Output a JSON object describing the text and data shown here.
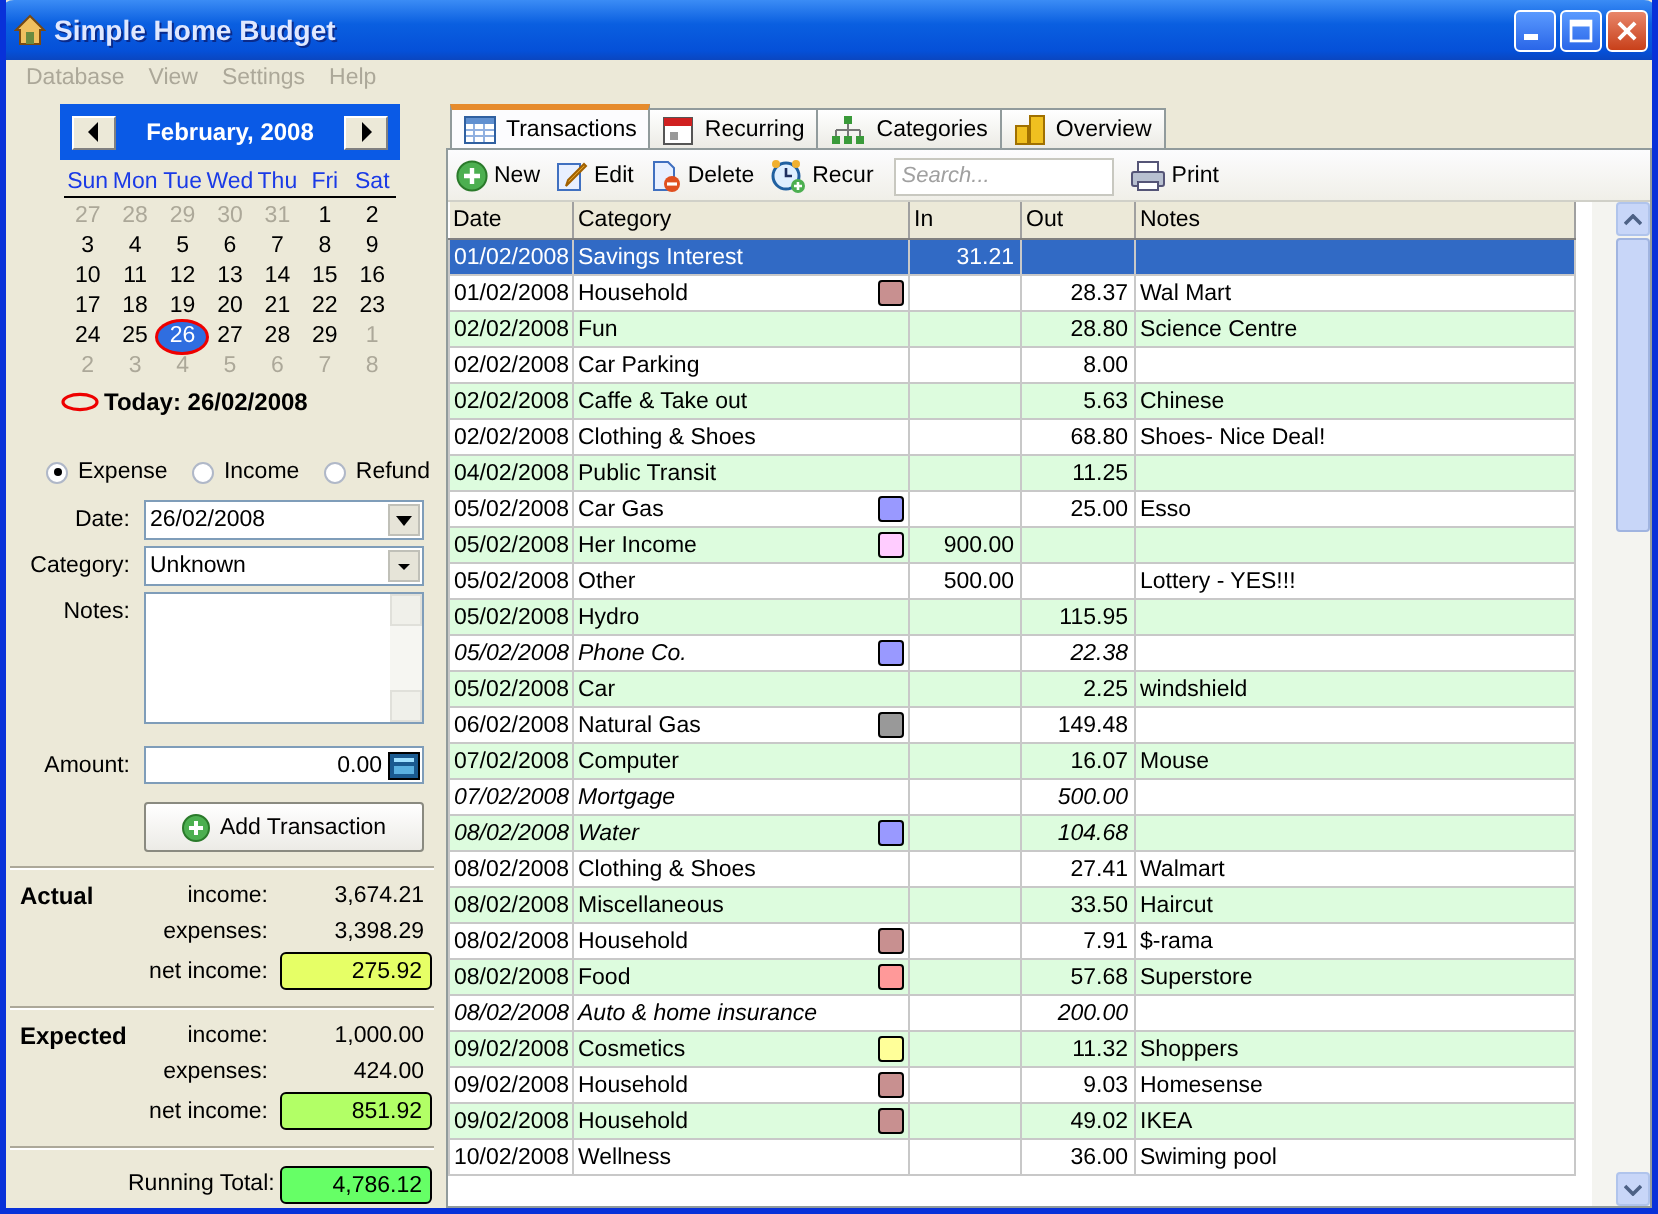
{
  "window": {
    "title": "Simple Home Budget"
  },
  "menu": [
    {
      "label": "Database",
      "disabled": true
    },
    {
      "label": "View",
      "disabled": true
    },
    {
      "label": "Settings",
      "disabled": true
    },
    {
      "label": "Help",
      "disabled": true
    }
  ],
  "calendar": {
    "month": "February, 2008",
    "weekdays": [
      "Sun",
      "Mon",
      "Tue",
      "Wed",
      "Thu",
      "Fri",
      "Sat"
    ],
    "weeks": [
      [
        {
          "d": "27",
          "outside": true,
          "selected": false
        },
        {
          "d": "28",
          "outside": true,
          "selected": false
        },
        {
          "d": "29",
          "outside": true,
          "selected": false
        },
        {
          "d": "30",
          "outside": true,
          "selected": false
        },
        {
          "d": "31",
          "outside": true,
          "selected": false
        },
        {
          "d": "1",
          "outside": false,
          "selected": false
        },
        {
          "d": "2",
          "outside": false,
          "selected": false
        }
      ],
      [
        {
          "d": "3",
          "outside": false,
          "selected": false
        },
        {
          "d": "4",
          "outside": false,
          "selected": false
        },
        {
          "d": "5",
          "outside": false,
          "selected": false
        },
        {
          "d": "6",
          "outside": false,
          "selected": false
        },
        {
          "d": "7",
          "outside": false,
          "selected": false
        },
        {
          "d": "8",
          "outside": false,
          "selected": false
        },
        {
          "d": "9",
          "outside": false,
          "selected": false
        }
      ],
      [
        {
          "d": "10",
          "outside": false,
          "selected": false
        },
        {
          "d": "11",
          "outside": false,
          "selected": false
        },
        {
          "d": "12",
          "outside": false,
          "selected": false
        },
        {
          "d": "13",
          "outside": false,
          "selected": false
        },
        {
          "d": "14",
          "outside": false,
          "selected": false
        },
        {
          "d": "15",
          "outside": false,
          "selected": false
        },
        {
          "d": "16",
          "outside": false,
          "selected": false
        }
      ],
      [
        {
          "d": "17",
          "outside": false,
          "selected": false
        },
        {
          "d": "18",
          "outside": false,
          "selected": false
        },
        {
          "d": "19",
          "outside": false,
          "selected": false
        },
        {
          "d": "20",
          "outside": false,
          "selected": false
        },
        {
          "d": "21",
          "outside": false,
          "selected": false
        },
        {
          "d": "22",
          "outside": false,
          "selected": false
        },
        {
          "d": "23",
          "outside": false,
          "selected": false
        }
      ],
      [
        {
          "d": "24",
          "outside": false,
          "selected": false
        },
        {
          "d": "25",
          "outside": false,
          "selected": false
        },
        {
          "d": "26",
          "outside": false,
          "selected": true
        },
        {
          "d": "27",
          "outside": false,
          "selected": false
        },
        {
          "d": "28",
          "outside": false,
          "selected": false
        },
        {
          "d": "29",
          "outside": false,
          "selected": false
        },
        {
          "d": "1",
          "outside": true,
          "selected": false
        }
      ],
      [
        {
          "d": "2",
          "outside": true,
          "selected": false
        },
        {
          "d": "3",
          "outside": true,
          "selected": false
        },
        {
          "d": "4",
          "outside": true,
          "selected": false
        },
        {
          "d": "5",
          "outside": true,
          "selected": false
        },
        {
          "d": "6",
          "outside": true,
          "selected": false
        },
        {
          "d": "7",
          "outside": true,
          "selected": false
        },
        {
          "d": "8",
          "outside": true,
          "selected": false
        }
      ]
    ],
    "today": "Today: 26/02/2008"
  },
  "types": [
    {
      "label": "Expense",
      "selected": true
    },
    {
      "label": "Income",
      "selected": false
    },
    {
      "label": "Refund",
      "selected": false
    }
  ],
  "form": {
    "date_label": "Date:",
    "date": "26/02/2008",
    "category_label": "Category:",
    "category": "Unknown",
    "notes_label": "Notes:",
    "amount_label": "Amount:",
    "amount": "0.00",
    "add_button": "Add Transaction"
  },
  "summary": [
    {
      "title": "Actual",
      "lines": [
        {
          "label": "income:",
          "value": "3,674.21"
        },
        {
          "label": "expenses:",
          "value": "3,398.29"
        },
        {
          "label": "net income:",
          "value": "275.92",
          "color": "#e6ff66"
        }
      ]
    },
    {
      "title": "Expected",
      "lines": [
        {
          "label": "income:",
          "value": "1,000.00"
        },
        {
          "label": "expenses:",
          "value": "424.00"
        },
        {
          "label": "net income:",
          "value": "851.92",
          "color": "#b2ff66"
        }
      ]
    }
  ],
  "running_total": {
    "label": "Running Total:",
    "value": "4,786.12",
    "color": "#66ff66"
  },
  "tabs": [
    {
      "label": "Transactions",
      "selected": true
    },
    {
      "label": "Recurring",
      "selected": false
    },
    {
      "label": "Categories",
      "selected": false
    },
    {
      "label": "Overview",
      "selected": false
    }
  ],
  "toolbar": {
    "buttons": [
      {
        "kind": "new",
        "label": "New"
      },
      {
        "kind": "edit",
        "label": "Edit"
      },
      {
        "kind": "delete",
        "label": "Delete"
      },
      {
        "kind": "recur",
        "label": "Recur"
      }
    ],
    "search": {
      "placeholder": "Search..."
    },
    "print": "Print"
  },
  "table": {
    "columns": [
      "Date",
      "Category",
      "In",
      "Out",
      "Notes"
    ],
    "rows": [
      {
        "date": "01/02/2008",
        "category": "Savings Interest",
        "in": "31.21",
        "selected": true,
        "scheduled": false
      },
      {
        "date": "01/02/2008",
        "category": "Household",
        "color": "#c89090",
        "out": "28.37",
        "notes": "Wal Mart",
        "selected": false,
        "scheduled": false
      },
      {
        "date": "02/02/2008",
        "category": "Fun",
        "out": "28.80",
        "notes": "Science Centre",
        "selected": false,
        "scheduled": false
      },
      {
        "date": "02/02/2008",
        "category": "Car Parking",
        "out": "8.00",
        "selected": false,
        "scheduled": false
      },
      {
        "date": "02/02/2008",
        "category": "Caffe & Take out",
        "out": "5.63",
        "notes": "Chinese",
        "selected": false,
        "scheduled": false
      },
      {
        "date": "02/02/2008",
        "category": "Clothing & Shoes",
        "out": "68.80",
        "notes": "Shoes- Nice Deal!",
        "selected": false,
        "scheduled": false
      },
      {
        "date": "04/02/2008",
        "category": "Public Transit",
        "out": "11.25",
        "selected": false,
        "scheduled": false
      },
      {
        "date": "05/02/2008",
        "category": "Car Gas",
        "color": "#9999ff",
        "out": "25.00",
        "notes": "Esso",
        "selected": false,
        "scheduled": false
      },
      {
        "date": "05/02/2008",
        "category": "Her Income",
        "color": "#ffccff",
        "in": "900.00",
        "selected": false,
        "scheduled": false
      },
      {
        "date": "05/02/2008",
        "category": "Other",
        "in": "500.00",
        "notes": "Lottery - YES!!!",
        "selected": false,
        "scheduled": false
      },
      {
        "date": "05/02/2008",
        "category": "Hydro",
        "out": "115.95",
        "selected": false,
        "scheduled": false
      },
      {
        "date": "05/02/2008",
        "category": "Phone Co.",
        "color": "#9999ff",
        "out": "22.38",
        "selected": false,
        "scheduled": true
      },
      {
        "date": "05/02/2008",
        "category": "Car",
        "out": "2.25",
        "notes": "windshield",
        "selected": false,
        "scheduled": false
      },
      {
        "date": "06/02/2008",
        "category": "Natural Gas",
        "color": "#999999",
        "out": "149.48",
        "selected": false,
        "scheduled": false
      },
      {
        "date": "07/02/2008",
        "category": "Computer",
        "out": "16.07",
        "notes": "Mouse",
        "selected": false,
        "scheduled": false
      },
      {
        "date": "07/02/2008",
        "category": "Mortgage",
        "out": "500.00",
        "selected": false,
        "scheduled": true
      },
      {
        "date": "08/02/2008",
        "category": "Water",
        "color": "#9999ff",
        "out": "104.68",
        "selected": false,
        "scheduled": true
      },
      {
        "date": "08/02/2008",
        "category": "Clothing & Shoes",
        "out": "27.41",
        "notes": "Walmart",
        "selected": false,
        "scheduled": false
      },
      {
        "date": "08/02/2008",
        "category": "Miscellaneous",
        "out": "33.50",
        "notes": "Haircut",
        "selected": false,
        "scheduled": false
      },
      {
        "date": "08/02/2008",
        "category": "Household",
        "color": "#c89090",
        "out": "7.91",
        "notes": "$-rama",
        "selected": false,
        "scheduled": false
      },
      {
        "date": "08/02/2008",
        "category": "Food",
        "color": "#ff9999",
        "out": "57.68",
        "notes": "Superstore",
        "selected": false,
        "scheduled": false
      },
      {
        "date": "08/02/2008",
        "category": "Auto & home insurance",
        "out": "200.00",
        "selected": false,
        "scheduled": true
      },
      {
        "date": "09/02/2008",
        "category": "Cosmetics",
        "color": "#ffff99",
        "out": "11.32",
        "notes": "Shoppers",
        "selected": false,
        "scheduled": false
      },
      {
        "date": "09/02/2008",
        "category": "Household",
        "color": "#c89090",
        "out": "9.03",
        "notes": "Homesense",
        "selected": false,
        "scheduled": false
      },
      {
        "date": "09/02/2008",
        "category": "Household",
        "color": "#c89090",
        "out": "49.02",
        "notes": "IKEA",
        "selected": false,
        "scheduled": false
      },
      {
        "date": "10/02/2008",
        "category": "Wellness",
        "out": "36.00",
        "notes": "Swiming pool",
        "selected": false,
        "scheduled": false
      }
    ]
  }
}
